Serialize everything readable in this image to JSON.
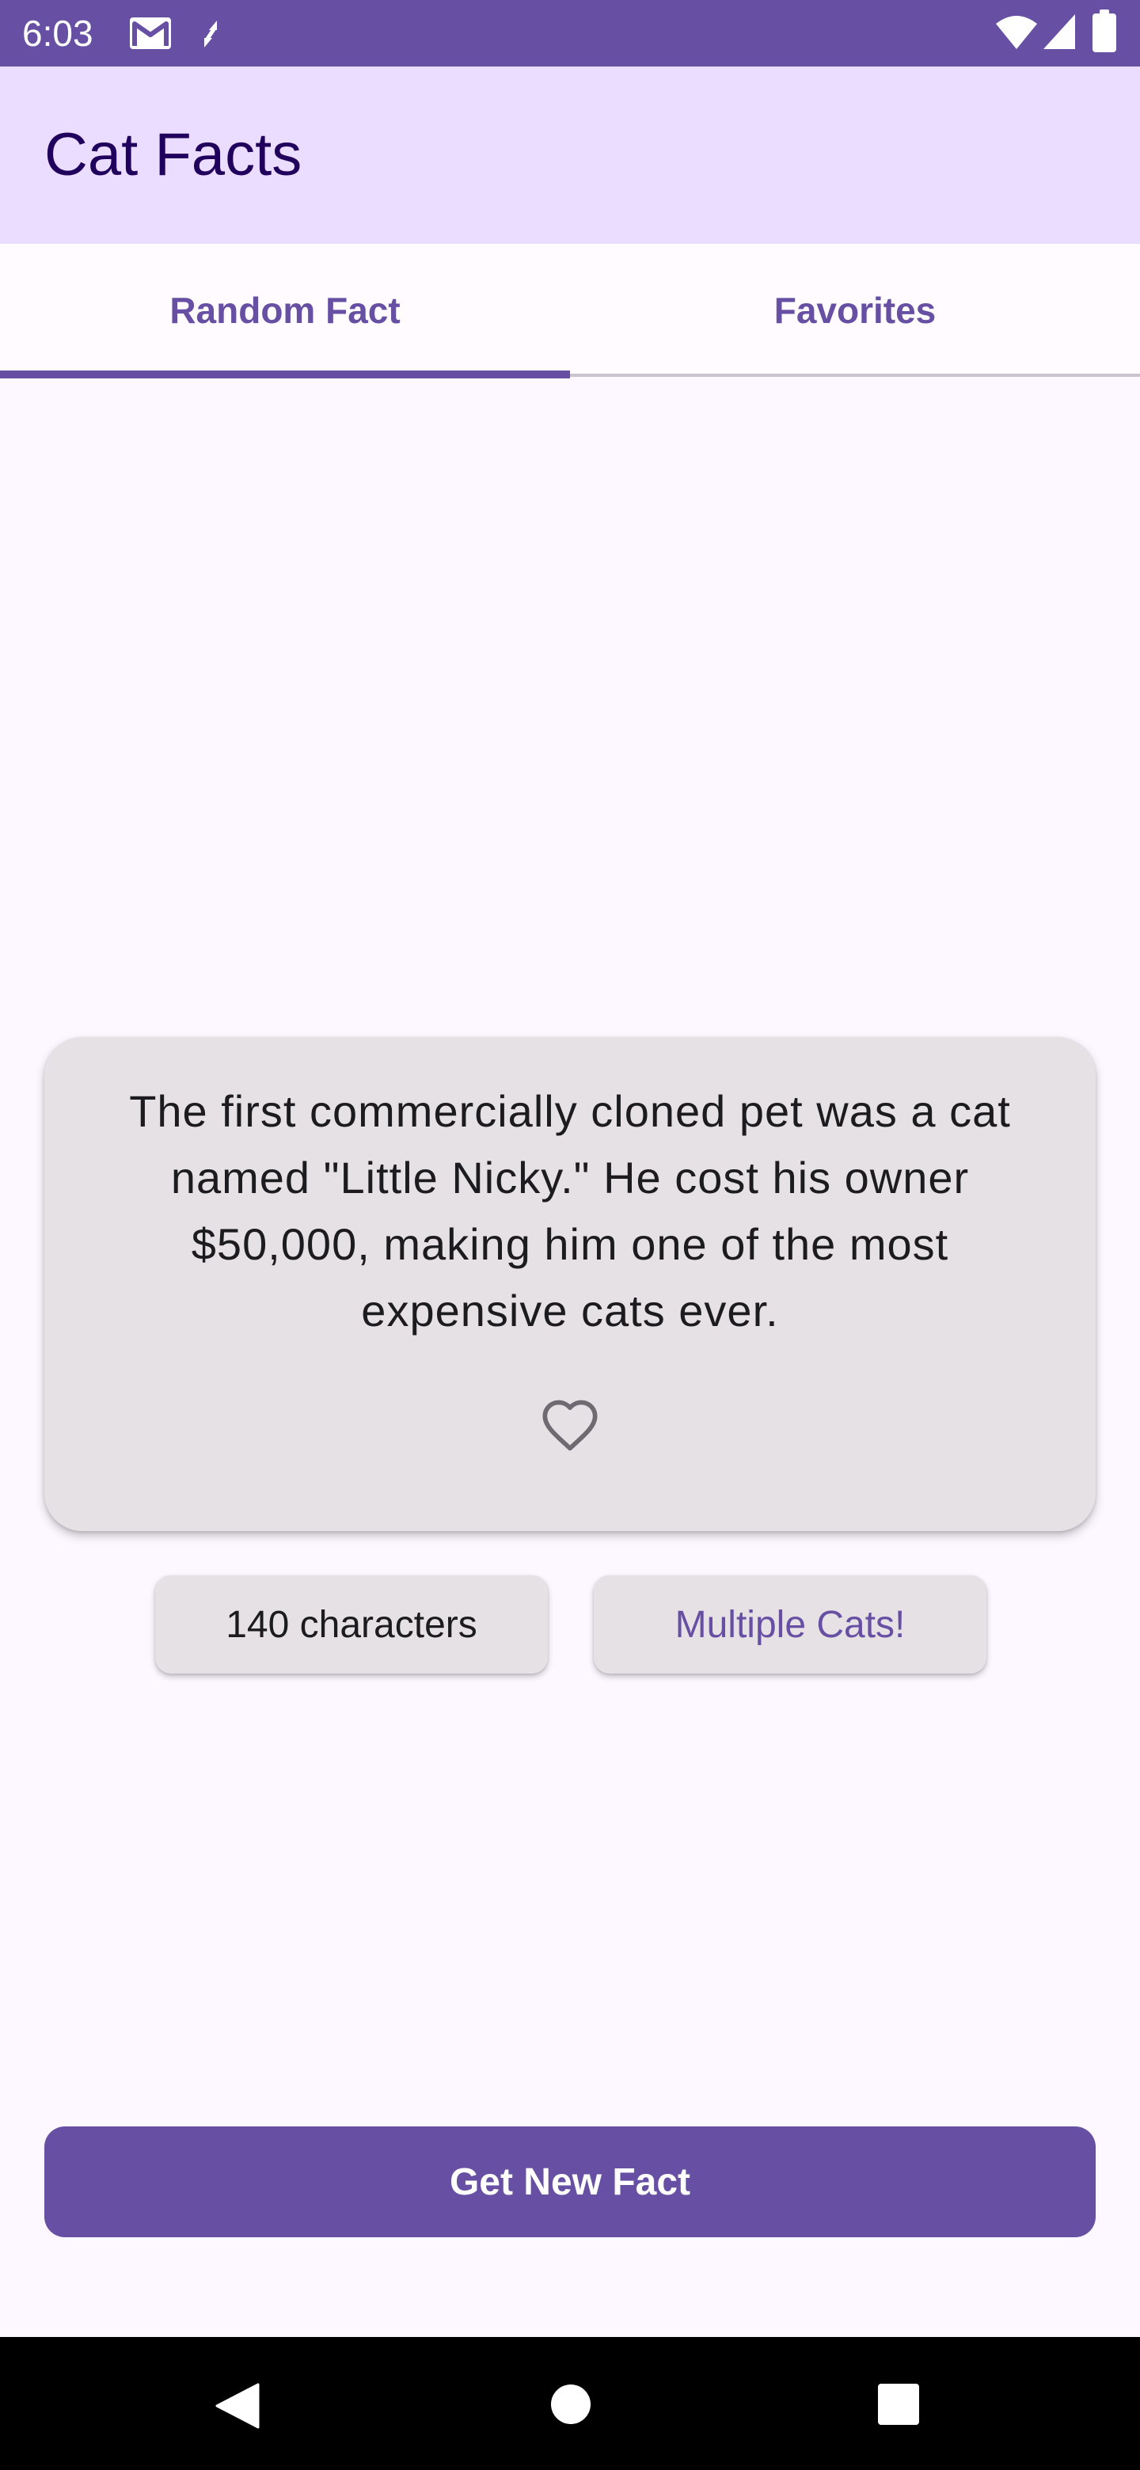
{
  "status_bar": {
    "time": "6:03",
    "background_color": "#6750a4",
    "icons": [
      "gmail-icon",
      "sync-icon",
      "wifi-icon",
      "signal-icon",
      "battery-icon"
    ]
  },
  "app_bar": {
    "title": "Cat Facts",
    "background_color": "#eaddff"
  },
  "tabs": [
    {
      "label": "Random Fact",
      "selected": true
    },
    {
      "label": "Favorites",
      "selected": false
    }
  ],
  "fact_card": {
    "text": "The first commercially cloned pet was a cat named \"Little Nicky.\" He cost his owner $50,000, making him one of the most expensive cats ever.",
    "favorite_icon": "heart-outline-icon",
    "favorited": false
  },
  "chips": {
    "length": "140 characters",
    "multiple": "Multiple Cats!"
  },
  "primary_action": {
    "label": "Get New Fact"
  },
  "navigation": {
    "icons": [
      "back-icon",
      "home-icon",
      "recents-icon"
    ]
  },
  "colors": {
    "primary": "#6750a4",
    "on_surface": "#1c1b1f",
    "card_surface": "#e6e1e5",
    "background": "#fdf7ff"
  }
}
